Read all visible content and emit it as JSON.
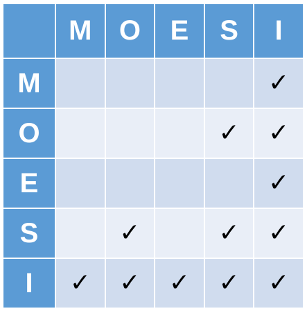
{
  "matrix": {
    "columns": [
      "M",
      "O",
      "E",
      "S",
      "I"
    ],
    "rows": [
      {
        "label": "M",
        "cells": [
          "",
          "",
          "",
          "",
          "✓"
        ]
      },
      {
        "label": "O",
        "cells": [
          "",
          "",
          "",
          "✓",
          "✓"
        ]
      },
      {
        "label": "E",
        "cells": [
          "",
          "",
          "",
          "",
          "✓"
        ]
      },
      {
        "label": "S",
        "cells": [
          "",
          "✓",
          "",
          "✓",
          "✓"
        ]
      },
      {
        "label": "I",
        "cells": [
          "✓",
          "✓",
          "✓",
          "✓",
          "✓"
        ]
      }
    ]
  },
  "colors": {
    "header": "#5b9bd5",
    "band_row": "#d0dcee",
    "plain_row": "#e9eef7",
    "grid_line": "#ffffff"
  }
}
